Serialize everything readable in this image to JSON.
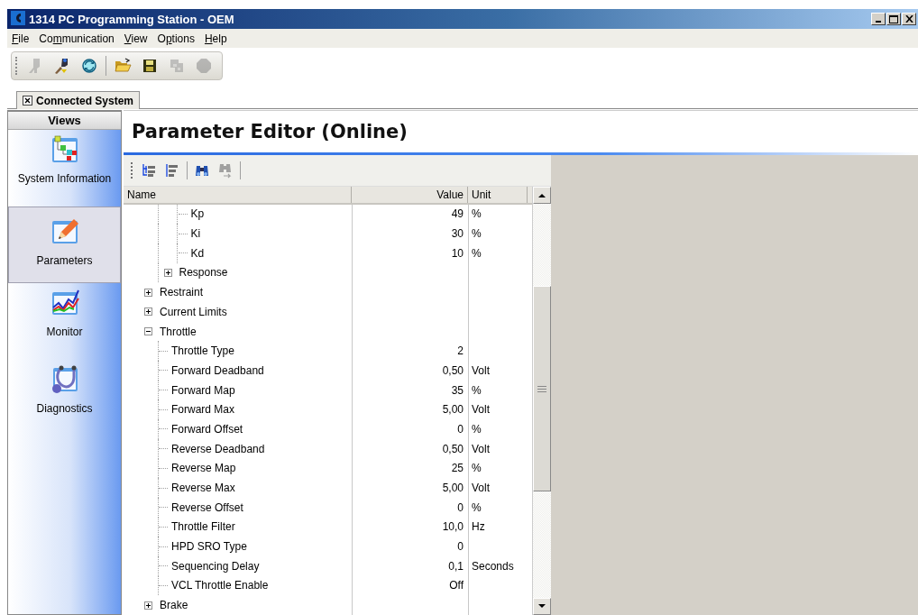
{
  "window": {
    "title": "1314 PC Programming Station - OEM"
  },
  "menu": [
    {
      "key": "F",
      "rest": "ile"
    },
    {
      "before": "Co",
      "key": "m",
      "rest": "munication"
    },
    {
      "key": "V",
      "rest": "iew"
    },
    {
      "before": "O",
      "key": "p",
      "rest": "tions"
    },
    {
      "key": "H",
      "rest": "elp"
    }
  ],
  "toolbar": [
    {
      "kind": "plug",
      "disabled": true
    },
    {
      "kind": "connect",
      "disabled": false
    },
    {
      "kind": "refresh",
      "disabled": false
    },
    {
      "kind": "separator"
    },
    {
      "kind": "open",
      "disabled": false
    },
    {
      "kind": "save",
      "disabled": false
    },
    {
      "kind": "chip",
      "disabled": true
    },
    {
      "kind": "stop",
      "disabled": true
    }
  ],
  "tabs": [
    {
      "label": "Connected System",
      "selected": true
    }
  ],
  "views": {
    "title": "Views",
    "items": [
      {
        "kind": "system",
        "label": "System Information",
        "selected": false
      },
      {
        "kind": "parameters",
        "label": "Parameters",
        "selected": true
      },
      {
        "kind": "monitor",
        "label": "Monitor",
        "selected": false
      },
      {
        "kind": "diagnostics",
        "label": "Diagnostics",
        "selected": false
      }
    ]
  },
  "editor": {
    "title": "Parameter Editor (Online)",
    "toolbar": [
      {
        "kind": "expand-all",
        "disabled": false
      },
      {
        "kind": "collapse-all",
        "disabled": false
      },
      {
        "kind": "separator"
      },
      {
        "kind": "find",
        "disabled": false
      },
      {
        "kind": "find-next",
        "disabled": true
      },
      {
        "kind": "separator"
      }
    ],
    "columns": [
      "Name",
      "Value",
      "Unit"
    ],
    "tree": [
      {
        "children": [
          {
            "children": [
              {
                "children": [
                  {
                    "name": "Kp",
                    "value": "49",
                    "unit": "%"
                  },
                  {
                    "name": "Ki",
                    "value": "30",
                    "unit": "%"
                  },
                  {
                    "name": "Kd",
                    "value": "10",
                    "unit": "%"
                  }
                ]
              },
              {
                "name": "Response",
                "expanded": false
              }
            ]
          },
          {
            "name": "Restraint",
            "expanded": false
          },
          {
            "name": "Current Limits",
            "expanded": false
          },
          {
            "name": "Throttle",
            "expanded": true,
            "children": [
              {
                "name": "Throttle Type",
                "value": "2"
              },
              {
                "name": "Forward Deadband",
                "value": "0,50",
                "unit": "Volt"
              },
              {
                "name": "Forward Map",
                "value": "35",
                "unit": "%"
              },
              {
                "name": "Forward Max",
                "value": "5,00",
                "unit": "Volt"
              },
              {
                "name": "Forward Offset",
                "value": "0",
                "unit": "%"
              },
              {
                "name": "Reverse Deadband",
                "value": "0,50",
                "unit": "Volt"
              },
              {
                "name": "Reverse Map",
                "value": "25",
                "unit": "%"
              },
              {
                "name": "Reverse Max",
                "value": "5,00",
                "unit": "Volt"
              },
              {
                "name": "Reverse Offset",
                "value": "0",
                "unit": "%"
              },
              {
                "name": "Throttle Filter",
                "value": "10,0",
                "unit": "Hz"
              },
              {
                "name": "HPD SRO Type",
                "value": "0"
              },
              {
                "name": "Sequencing Delay",
                "value": "0,1",
                "unit": "Seconds"
              },
              {
                "name": "VCL Throttle Enable",
                "value": "Off"
              }
            ]
          },
          {
            "name": "Brake",
            "expanded": false
          }
        ]
      }
    ]
  }
}
